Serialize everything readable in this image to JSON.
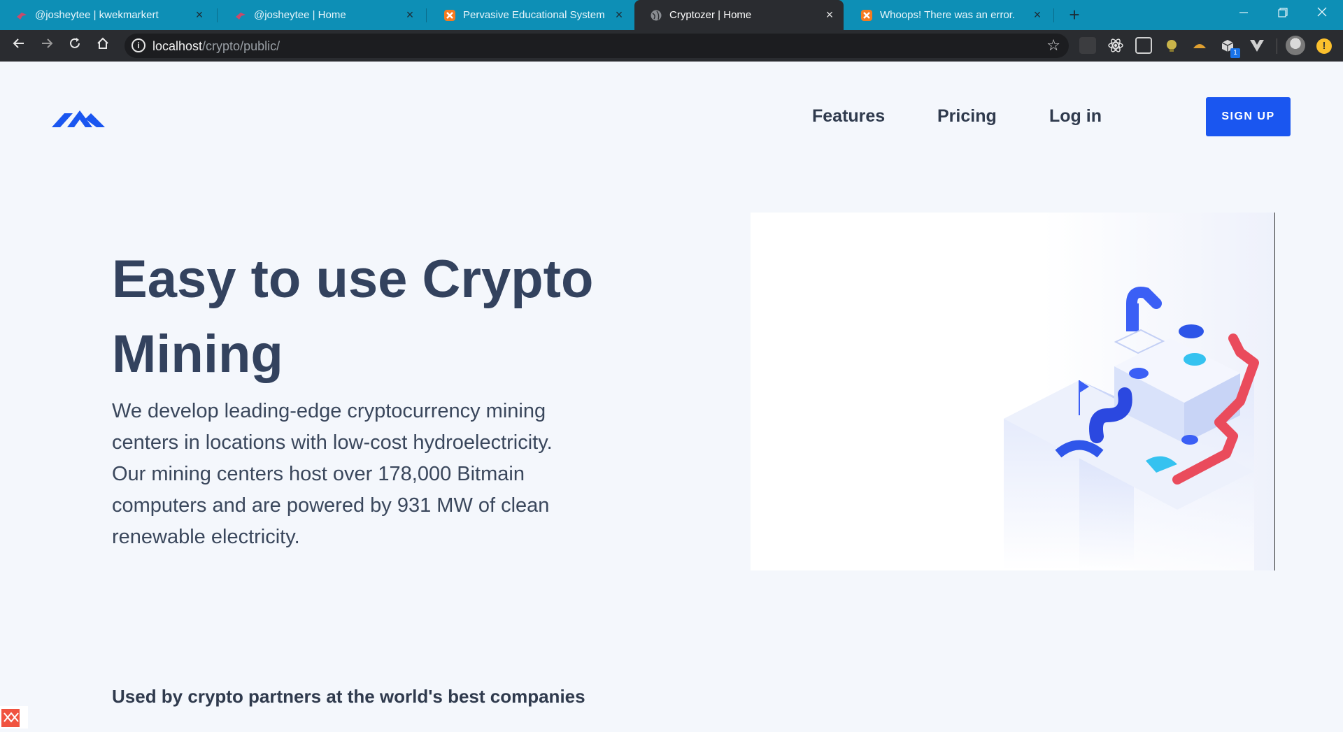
{
  "browser": {
    "tabs": [
      {
        "title": "@josheytee | kwekmarkert",
        "icon": "bird-favicon-icon",
        "active": false
      },
      {
        "title": "@josheytee | Home",
        "icon": "bird-favicon-icon",
        "active": false
      },
      {
        "title": "Pervasive Educational System",
        "icon": "xampp-favicon-icon",
        "active": false
      },
      {
        "title": "Cryptozer | Home",
        "icon": "globe-favicon-icon",
        "active": true
      },
      {
        "title": "Whoops! There was an error.",
        "icon": "xampp-favicon-icon",
        "active": false
      }
    ],
    "close_glyph": "×",
    "url_host": "localhost",
    "url_path": "/crypto/public/",
    "extension_badge": "1",
    "update_indicator": "!",
    "colors": {
      "tabbar": "#0d8fb6",
      "toolbar": "#2a2c30"
    }
  },
  "header": {
    "nav": {
      "features": "Features",
      "pricing": "Pricing",
      "login": "Log in"
    },
    "signup_label": "SIGN UP",
    "accent_color": "#1a56f0"
  },
  "hero": {
    "title": "Easy to use Crypto Mining",
    "description": "We develop leading-edge cryptocurrency mining centers in locations with low-cost hydroelectricity. Our mining centers host over 178,000 Bitmain computers and are powered by 931 MW of clean renewable electricity."
  },
  "partners": {
    "heading": "Used by crypto partners at the world's best companies"
  }
}
